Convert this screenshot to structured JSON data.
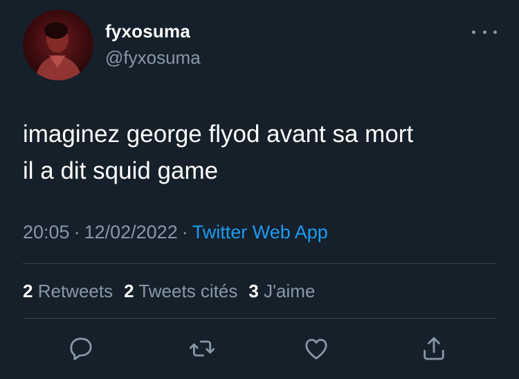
{
  "user": {
    "display_name": "fyxosuma",
    "handle": "@fyxosuma"
  },
  "tweet": {
    "lines": [
      "imaginez george flyod avant sa mort",
      "il a dit squid game"
    ],
    "time": "20:05",
    "date": "12/02/2022",
    "separator": "·",
    "source": "Twitter Web App"
  },
  "stats": {
    "retweets_count": "2",
    "retweets_label": "Retweets",
    "quotes_count": "2",
    "quotes_label": "Tweets cités",
    "likes_count": "3",
    "likes_label": "J'aime"
  },
  "icons": {
    "more": "more-horizontal-icon",
    "reply": "reply-icon",
    "retweet": "retweet-icon",
    "like": "heart-icon",
    "share": "share-icon"
  },
  "colors": {
    "background": "#15202b",
    "secondary_text": "#8899a6",
    "link": "#1d9bf0",
    "divider": "#38444d"
  }
}
